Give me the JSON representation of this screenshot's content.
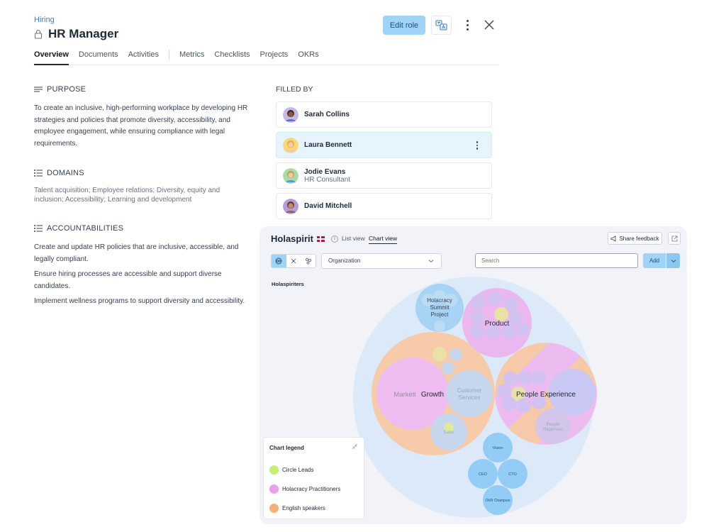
{
  "header": {
    "breadcrumb": "Hiring",
    "title": "HR Manager",
    "edit_label": "Edit role"
  },
  "tabs": [
    "Overview",
    "Documents",
    "Activities",
    "Metrics",
    "Checklists",
    "Projects",
    "OKRs"
  ],
  "purpose": {
    "heading": "PURPOSE",
    "text": "To create an inclusive, high-performing workplace by developing HR strategies and policies that promote diversity, accessibility, and employee engagement, while ensuring compliance with legal requirements."
  },
  "domains": {
    "heading": "DOMAINS",
    "text": "Talent acquisition; Employee relations; Diversity, equity and inclusion; Accessibility; Learning and development"
  },
  "accountabilities": {
    "heading": "ACCOUNTABILITIES",
    "items": [
      "Create and update HR policies that are inclusive, accessible, and legally compliant.",
      "Ensure hiring processes are accessible and support diverse candidates.",
      "Implement wellness programs to support diversity and accessibility."
    ]
  },
  "filled_by": {
    "heading": "FILLED BY",
    "people": [
      {
        "name": "Sarah Collins",
        "role": ""
      },
      {
        "name": "Laura Bennett",
        "role": ""
      },
      {
        "name": "Jodie Evans",
        "role": "HR Consultant"
      },
      {
        "name": "David Mitchell",
        "role": ""
      }
    ]
  },
  "panel": {
    "brand": "Holaspirit",
    "list_view": "List view",
    "chart_view": "Chart view",
    "share_feedback": "Share feedback",
    "org_select": "Organization",
    "search_placeholder": "Search",
    "add_label": "Add",
    "root_label": "Holaspiriters",
    "circles": {
      "holacracy": [
        "Holacracy",
        "Summit",
        "Project"
      ],
      "product": "Product",
      "marketing": "Marketi",
      "growth": "Growth",
      "customer": [
        "Customer",
        "Services"
      ],
      "people": "People Experience",
      "people_happiness": [
        "People",
        "Happiness"
      ],
      "sales": "Sales",
      "vision": "Vision",
      "ceo": "CEO",
      "cto": "CTO",
      "okr": "OKR Champion"
    },
    "legend": {
      "title": "Chart legend",
      "items": [
        {
          "label": "Circle Leads",
          "color": "#c6ee73"
        },
        {
          "label": "Holacracy Practitioners",
          "color": "#ec9df0"
        },
        {
          "label": "English speakers",
          "color": "#f6b17a"
        }
      ]
    }
  },
  "colors": {
    "accent": "#9fd3f7",
    "link": "#2f7de1"
  }
}
